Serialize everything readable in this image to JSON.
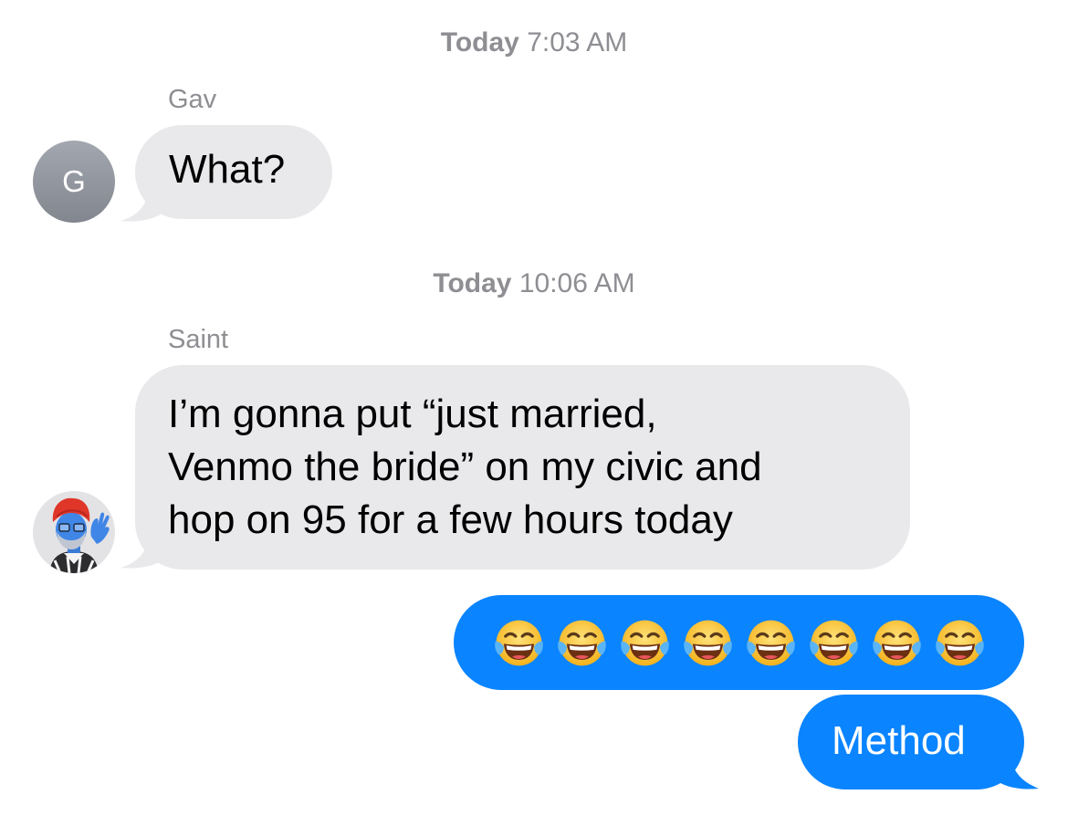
{
  "conversation": [
    {
      "timestamp": {
        "day": "Today",
        "time": "7:03 AM"
      },
      "sender": "Gav",
      "avatar_initial": "G",
      "message": "What?"
    },
    {
      "timestamp": {
        "day": "Today",
        "time": "10:06 AM"
      },
      "sender": "Saint",
      "avatar_icon": "memoji-waving-icon",
      "message_lines": [
        "I’m gonna put “just married,",
        "Venmo the bride” on my civic and",
        "hop on 95 for a few hours today"
      ]
    }
  ],
  "outgoing": {
    "emoji_icon": "face-with-tears-of-joy-icon",
    "emoji_count": 8,
    "reply": "Method"
  },
  "colors": {
    "incoming_bubble": "#e9e9eb",
    "outgoing_bubble": "#0a84ff",
    "meta_text": "#8e8e93"
  }
}
